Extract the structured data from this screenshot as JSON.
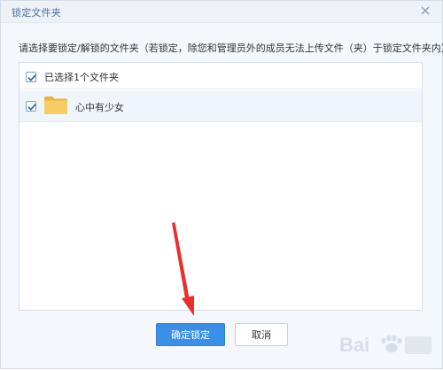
{
  "dialog": {
    "title": "锁定文件夹",
    "description": "请选择要锁定/解锁的文件夹（若锁定，除您和管理员外的成员无法上传文件（夹）于锁定文件夹内）"
  },
  "list": {
    "select_all_label": "已选择1个文件夹",
    "select_all_checked": true,
    "items": [
      {
        "name": "心中有少女",
        "checked": true
      }
    ]
  },
  "buttons": {
    "confirm_label": "确定锁定",
    "cancel_label": "取消"
  },
  "colors": {
    "primary": "#3b8fe8",
    "title_text": "#4a6f9b",
    "folder": "#f5c85b",
    "annotation_arrow": "#e8302c"
  },
  "watermark": {
    "text": "Bai"
  }
}
